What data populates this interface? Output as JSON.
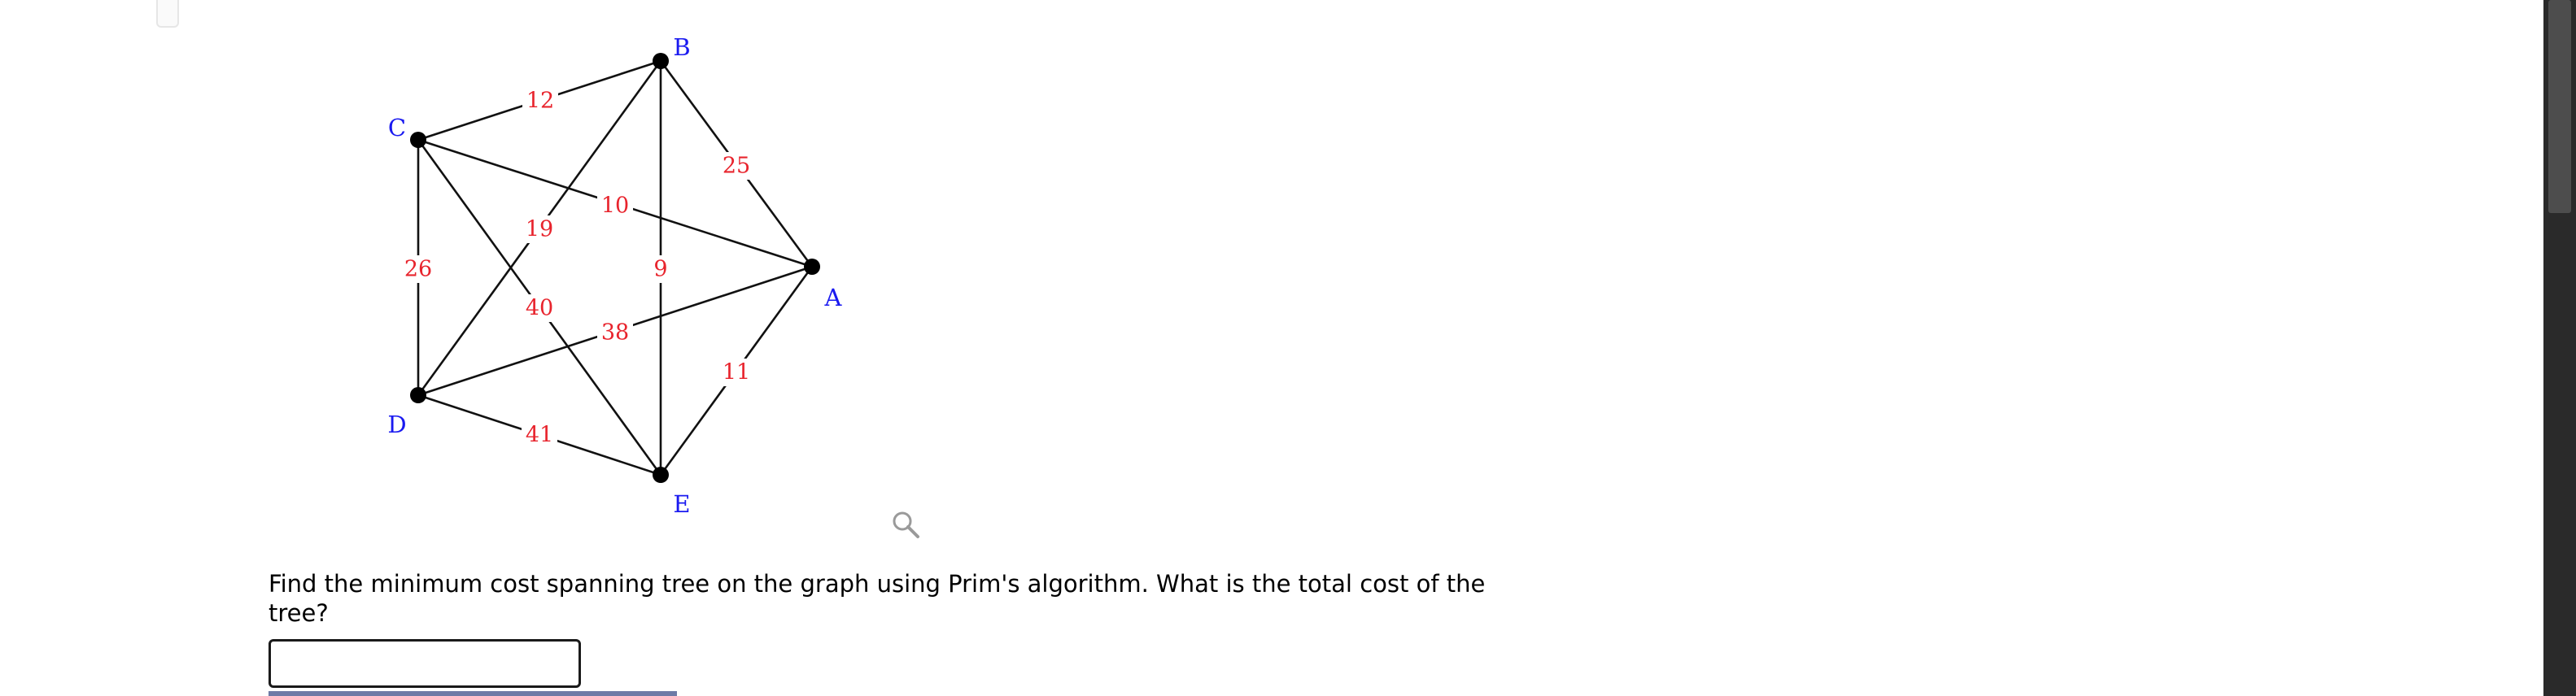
{
  "graph": {
    "vertices": [
      {
        "id": "A",
        "label": "A"
      },
      {
        "id": "B",
        "label": "B"
      },
      {
        "id": "C",
        "label": "C"
      },
      {
        "id": "D",
        "label": "D"
      },
      {
        "id": "E",
        "label": "E"
      }
    ],
    "edges": [
      {
        "from": "C",
        "to": "B",
        "weight": "12"
      },
      {
        "from": "B",
        "to": "A",
        "weight": "25"
      },
      {
        "from": "C",
        "to": "A",
        "weight": "10"
      },
      {
        "from": "B",
        "to": "D",
        "weight": "19"
      },
      {
        "from": "B",
        "to": "E",
        "weight": "9"
      },
      {
        "from": "C",
        "to": "D",
        "weight": "26"
      },
      {
        "from": "C",
        "to": "E",
        "weight": "40"
      },
      {
        "from": "D",
        "to": "A",
        "weight": "38"
      },
      {
        "from": "A",
        "to": "E",
        "weight": "11"
      },
      {
        "from": "D",
        "to": "E",
        "weight": "41"
      }
    ],
    "colors": {
      "vertex_label": "#1a1af0",
      "weight": "#e8242d",
      "edge": "#111111"
    }
  },
  "question": {
    "text": "Find the minimum cost spanning tree on the graph using Prim's algorithm. What is the total cost of the tree?"
  },
  "answer": {
    "value": "",
    "placeholder": ""
  },
  "icons": {
    "zoom": "magnifier-icon"
  }
}
